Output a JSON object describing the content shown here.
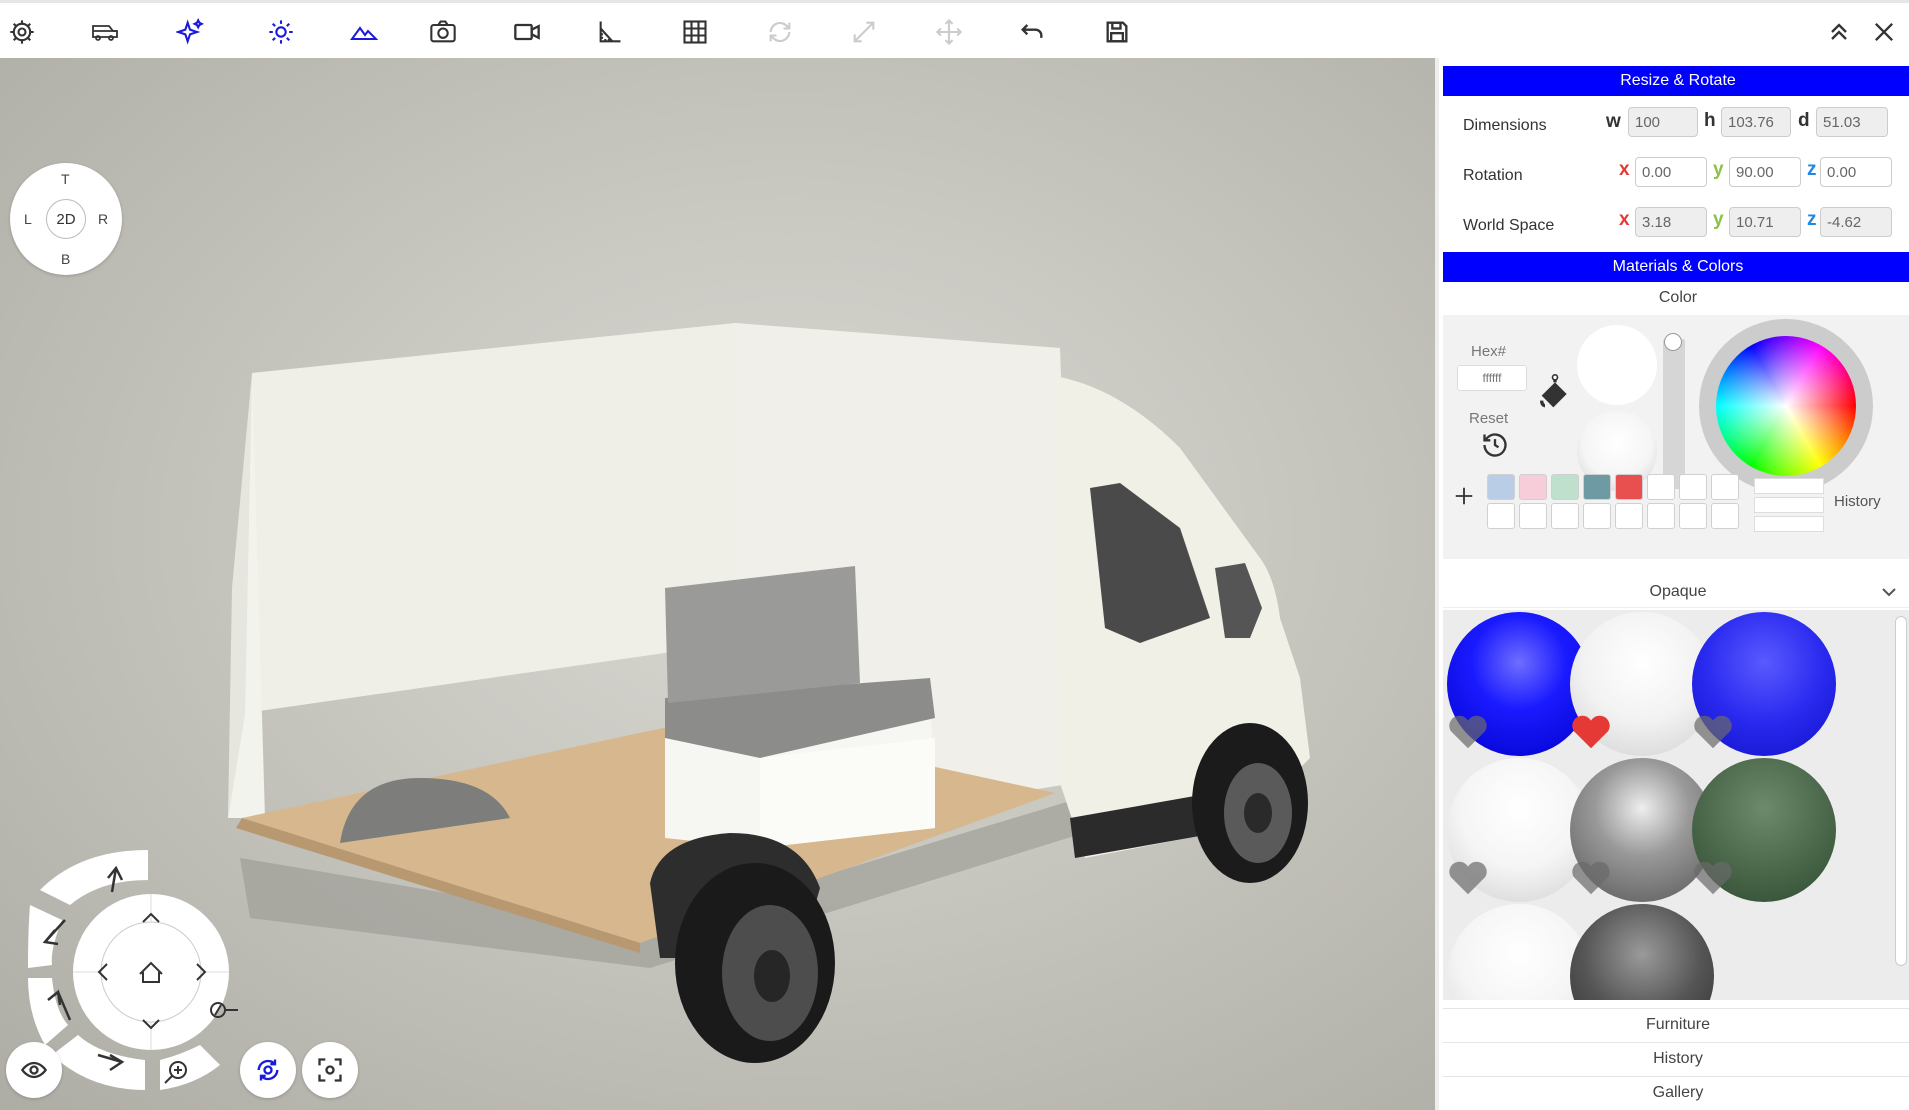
{
  "toolbar": {
    "icons": [
      "gear-icon",
      "van-icon",
      "sparkle-icon",
      "sun-icon",
      "mountains-icon",
      "camera-icon",
      "video-icon",
      "ruler-icon",
      "grid-icon",
      "rotate-icon",
      "scale-icon",
      "move-icon",
      "undo-icon",
      "save-icon",
      "collapse-icon",
      "close-icon"
    ]
  },
  "viewcube": {
    "top": "T",
    "left": "L",
    "right": "R",
    "bottom": "B",
    "center": "2D"
  },
  "resize_rotate": {
    "title": "Resize & Rotate",
    "dimensions": {
      "label": "Dimensions",
      "w_label": "w",
      "h_label": "h",
      "d_label": "d",
      "w": "100",
      "h": "103.76",
      "d": "51.03"
    },
    "rotation": {
      "label": "Rotation",
      "x": "0.00",
      "y": "90.00",
      "z": "0.00"
    },
    "world_space": {
      "label": "World Space",
      "x": "3.18",
      "y": "10.71",
      "z": "-4.62"
    },
    "axis_labels": {
      "x": "x",
      "y": "y",
      "z": "z"
    },
    "axis_colors": {
      "x": "#e53935",
      "y": "#8bc34a",
      "z": "#1e88e5"
    }
  },
  "materials": {
    "title": "Materials & Colors",
    "color_label": "Color",
    "hex_label": "Hex#",
    "hex_placeholder": "ffffff",
    "reset_label": "Reset",
    "history_label": "History",
    "swatches": [
      "#b9cde6",
      "#f6cdd8",
      "#bfe0cc",
      "#6e9aa4",
      "#e85050",
      "#ffffff",
      "#ffffff",
      "#ffffff"
    ],
    "filter_label": "Opaque",
    "favorites": [
      false,
      true,
      false,
      false,
      false,
      false
    ]
  },
  "tabs": {
    "furniture": "Furniture",
    "history": "History",
    "gallery": "Gallery"
  },
  "colors": {
    "accent": "#0000ff",
    "heart_active": "#e53935"
  }
}
